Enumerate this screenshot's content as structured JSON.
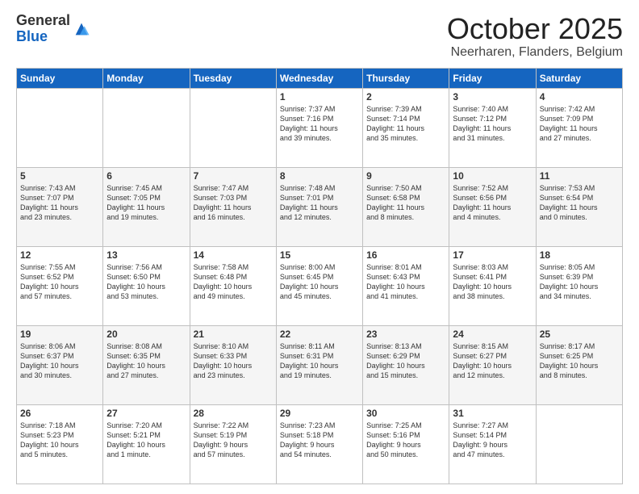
{
  "logo": {
    "general": "General",
    "blue": "Blue"
  },
  "header": {
    "month": "October 2025",
    "location": "Neerharen, Flanders, Belgium"
  },
  "days_of_week": [
    "Sunday",
    "Monday",
    "Tuesday",
    "Wednesday",
    "Thursday",
    "Friday",
    "Saturday"
  ],
  "weeks": [
    [
      {
        "day": "",
        "info": ""
      },
      {
        "day": "",
        "info": ""
      },
      {
        "day": "",
        "info": ""
      },
      {
        "day": "1",
        "info": "Sunrise: 7:37 AM\nSunset: 7:16 PM\nDaylight: 11 hours\nand 39 minutes."
      },
      {
        "day": "2",
        "info": "Sunrise: 7:39 AM\nSunset: 7:14 PM\nDaylight: 11 hours\nand 35 minutes."
      },
      {
        "day": "3",
        "info": "Sunrise: 7:40 AM\nSunset: 7:12 PM\nDaylight: 11 hours\nand 31 minutes."
      },
      {
        "day": "4",
        "info": "Sunrise: 7:42 AM\nSunset: 7:09 PM\nDaylight: 11 hours\nand 27 minutes."
      }
    ],
    [
      {
        "day": "5",
        "info": "Sunrise: 7:43 AM\nSunset: 7:07 PM\nDaylight: 11 hours\nand 23 minutes."
      },
      {
        "day": "6",
        "info": "Sunrise: 7:45 AM\nSunset: 7:05 PM\nDaylight: 11 hours\nand 19 minutes."
      },
      {
        "day": "7",
        "info": "Sunrise: 7:47 AM\nSunset: 7:03 PM\nDaylight: 11 hours\nand 16 minutes."
      },
      {
        "day": "8",
        "info": "Sunrise: 7:48 AM\nSunset: 7:01 PM\nDaylight: 11 hours\nand 12 minutes."
      },
      {
        "day": "9",
        "info": "Sunrise: 7:50 AM\nSunset: 6:58 PM\nDaylight: 11 hours\nand 8 minutes."
      },
      {
        "day": "10",
        "info": "Sunrise: 7:52 AM\nSunset: 6:56 PM\nDaylight: 11 hours\nand 4 minutes."
      },
      {
        "day": "11",
        "info": "Sunrise: 7:53 AM\nSunset: 6:54 PM\nDaylight: 11 hours\nand 0 minutes."
      }
    ],
    [
      {
        "day": "12",
        "info": "Sunrise: 7:55 AM\nSunset: 6:52 PM\nDaylight: 10 hours\nand 57 minutes."
      },
      {
        "day": "13",
        "info": "Sunrise: 7:56 AM\nSunset: 6:50 PM\nDaylight: 10 hours\nand 53 minutes."
      },
      {
        "day": "14",
        "info": "Sunrise: 7:58 AM\nSunset: 6:48 PM\nDaylight: 10 hours\nand 49 minutes."
      },
      {
        "day": "15",
        "info": "Sunrise: 8:00 AM\nSunset: 6:45 PM\nDaylight: 10 hours\nand 45 minutes."
      },
      {
        "day": "16",
        "info": "Sunrise: 8:01 AM\nSunset: 6:43 PM\nDaylight: 10 hours\nand 41 minutes."
      },
      {
        "day": "17",
        "info": "Sunrise: 8:03 AM\nSunset: 6:41 PM\nDaylight: 10 hours\nand 38 minutes."
      },
      {
        "day": "18",
        "info": "Sunrise: 8:05 AM\nSunset: 6:39 PM\nDaylight: 10 hours\nand 34 minutes."
      }
    ],
    [
      {
        "day": "19",
        "info": "Sunrise: 8:06 AM\nSunset: 6:37 PM\nDaylight: 10 hours\nand 30 minutes."
      },
      {
        "day": "20",
        "info": "Sunrise: 8:08 AM\nSunset: 6:35 PM\nDaylight: 10 hours\nand 27 minutes."
      },
      {
        "day": "21",
        "info": "Sunrise: 8:10 AM\nSunset: 6:33 PM\nDaylight: 10 hours\nand 23 minutes."
      },
      {
        "day": "22",
        "info": "Sunrise: 8:11 AM\nSunset: 6:31 PM\nDaylight: 10 hours\nand 19 minutes."
      },
      {
        "day": "23",
        "info": "Sunrise: 8:13 AM\nSunset: 6:29 PM\nDaylight: 10 hours\nand 15 minutes."
      },
      {
        "day": "24",
        "info": "Sunrise: 8:15 AM\nSunset: 6:27 PM\nDaylight: 10 hours\nand 12 minutes."
      },
      {
        "day": "25",
        "info": "Sunrise: 8:17 AM\nSunset: 6:25 PM\nDaylight: 10 hours\nand 8 minutes."
      }
    ],
    [
      {
        "day": "26",
        "info": "Sunrise: 7:18 AM\nSunset: 5:23 PM\nDaylight: 10 hours\nand 5 minutes."
      },
      {
        "day": "27",
        "info": "Sunrise: 7:20 AM\nSunset: 5:21 PM\nDaylight: 10 hours\nand 1 minute."
      },
      {
        "day": "28",
        "info": "Sunrise: 7:22 AM\nSunset: 5:19 PM\nDaylight: 9 hours\nand 57 minutes."
      },
      {
        "day": "29",
        "info": "Sunrise: 7:23 AM\nSunset: 5:18 PM\nDaylight: 9 hours\nand 54 minutes."
      },
      {
        "day": "30",
        "info": "Sunrise: 7:25 AM\nSunset: 5:16 PM\nDaylight: 9 hours\nand 50 minutes."
      },
      {
        "day": "31",
        "info": "Sunrise: 7:27 AM\nSunset: 5:14 PM\nDaylight: 9 hours\nand 47 minutes."
      },
      {
        "day": "",
        "info": ""
      }
    ]
  ]
}
